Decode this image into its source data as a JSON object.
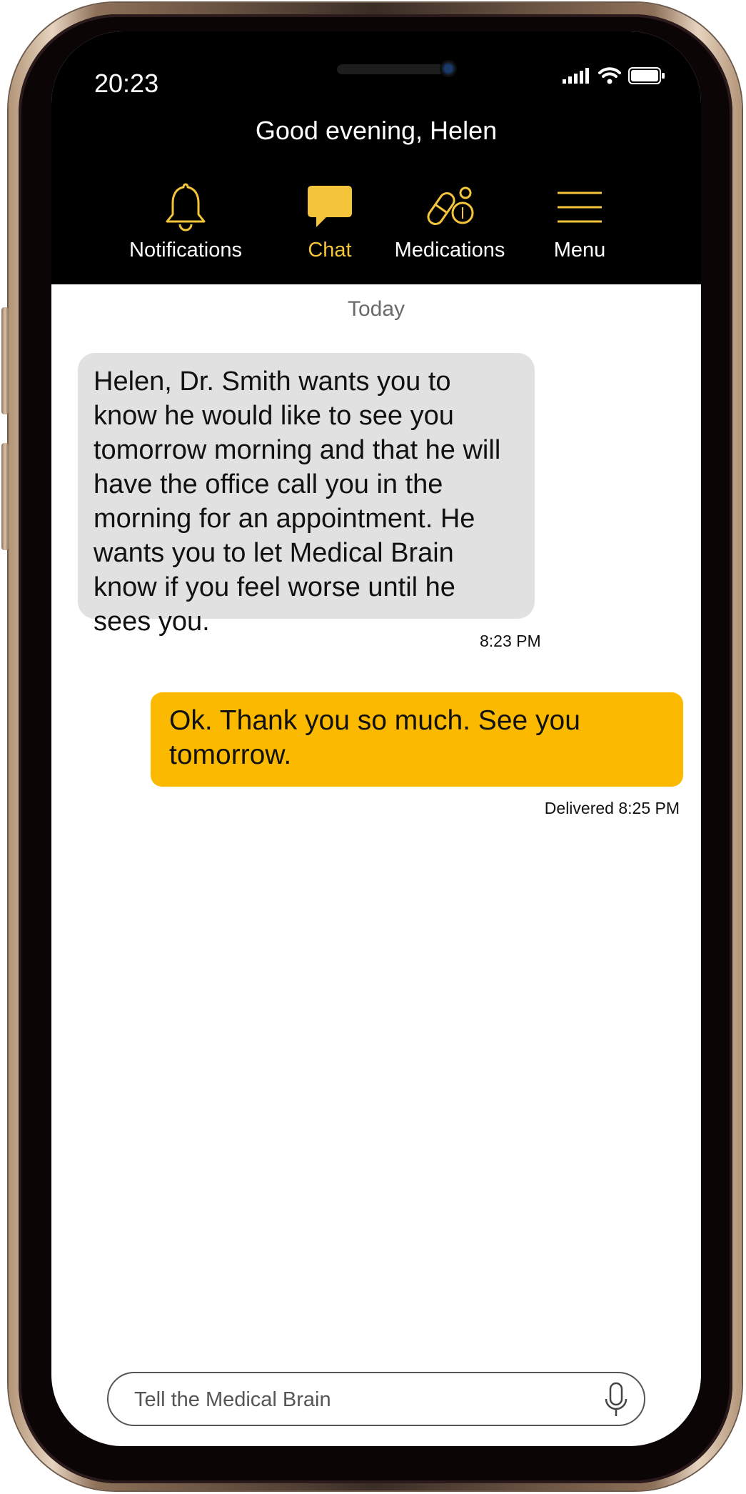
{
  "status_bar": {
    "time": "20:23"
  },
  "header": {
    "greeting": "Good evening, Helen"
  },
  "nav": {
    "items": [
      {
        "label": "Notifications",
        "icon": "bell-icon"
      },
      {
        "label": "Chat",
        "icon": "chat-icon",
        "active": true
      },
      {
        "label": "Medications",
        "icon": "pills-icon"
      },
      {
        "label": "Menu",
        "icon": "hamburger-icon"
      }
    ]
  },
  "chat": {
    "day_label": "Today",
    "messages": [
      {
        "direction": "incoming",
        "text": "Helen, Dr. Smith wants you to know he would like to see you tomorrow morning and that he will have the office call you in the morning for an appointment. He wants you to let Medical Brain know if you feel worse until he sees you.",
        "time": "8:23 PM"
      },
      {
        "direction": "outgoing",
        "text": "Ok. Thank you so much. See you tomorrow.",
        "time": "Delivered 8:25 PM"
      }
    ]
  },
  "input": {
    "placeholder": "Tell the Medical Brain",
    "value": ""
  },
  "colors": {
    "accent": "#fbba00",
    "header_bg": "#000000",
    "incoming_bubble": "#e1e1e1",
    "icon_yellow": "#f4c43a"
  }
}
